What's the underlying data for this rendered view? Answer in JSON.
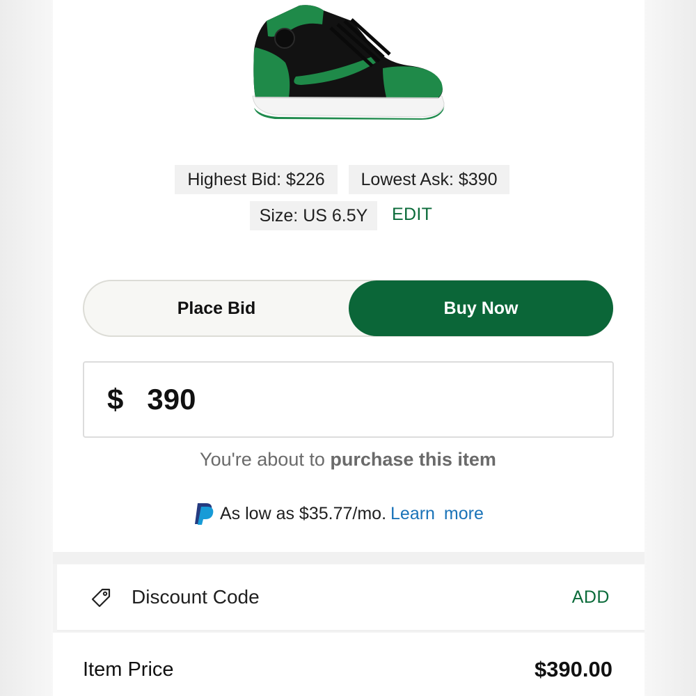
{
  "market": {
    "highest_bid": "Highest Bid: $226",
    "lowest_ask": "Lowest Ask: $390",
    "size": "Size: US 6.5Y",
    "edit_label": "EDIT"
  },
  "mode_toggle": {
    "place_bid_label": "Place Bid",
    "buy_now_label": "Buy Now",
    "selected": "Buy Now"
  },
  "amount": {
    "currency_symbol": "$",
    "value": "390"
  },
  "notice": {
    "prefix": "You're about to ",
    "emphasis": "purchase this item"
  },
  "financing": {
    "icon": "paypal-icon",
    "text": "As low as $35.77/mo.",
    "link_label": "Learn more"
  },
  "discount": {
    "icon": "tag-icon",
    "label": "Discount Code",
    "action_label": "ADD"
  },
  "summary": {
    "item_price_label": "Item Price",
    "item_price_value": "$390.00"
  },
  "colors": {
    "brand_green": "#0b6638",
    "link_blue": "#1a73b8",
    "chip_gray": "#f1f1f1"
  }
}
